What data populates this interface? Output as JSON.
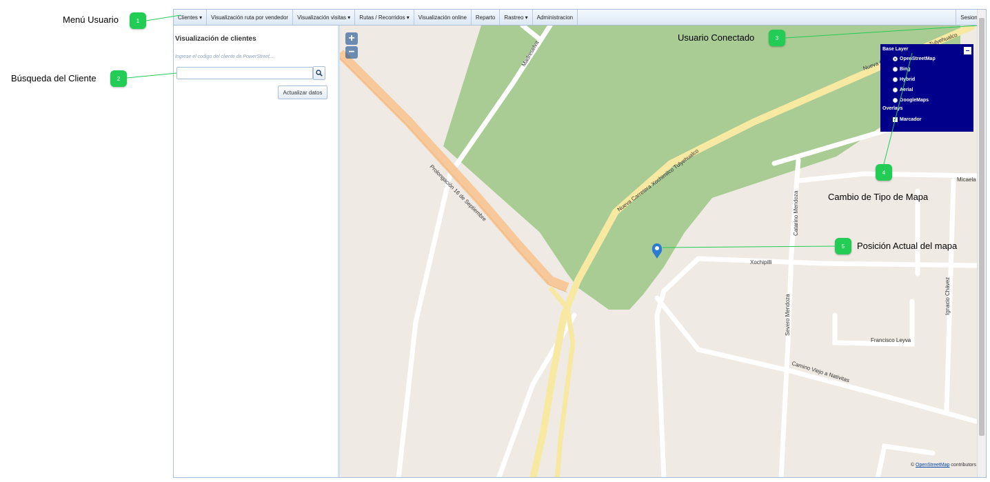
{
  "menu": {
    "items": [
      {
        "label": "Clientes ▾"
      },
      {
        "label": "Visualización ruta por vendedor"
      },
      {
        "label": "Visualización visitas ▾"
      },
      {
        "label": "Rutas / Recorridos ▾"
      },
      {
        "label": "Visualización online"
      },
      {
        "label": "Reparto"
      },
      {
        "label": "Rastreo ▾"
      },
      {
        "label": "Administracion"
      }
    ],
    "session_label": "Sesion ▾"
  },
  "sidebar": {
    "title": "Visualización de clientes",
    "hint": "Ingrese el codigo del cliente de PowerStreet...",
    "search_value": "",
    "refresh_label": "Actualizar datos"
  },
  "map": {
    "zoom_in": "+",
    "zoom_out": "−",
    "streets": {
      "madreselva": "Madreselva",
      "nueva_carretera": "Nueva Carretera Xochimilco Tulyehualco",
      "nueva_carretera_top": "Nueva Carretera Xochimilco Tulyehualco",
      "prolongacion": "Prolongación 16 de Septiembre",
      "catarino": "Catarino Mendoza",
      "xochipilli": "Xochipilli",
      "severo": "Severo Mendoza",
      "ignacio": "Ignacio Chávez",
      "francisco": "Francisco Leyva",
      "camino": "Camino Viejo a Nativitas",
      "micaela": "Micaela"
    },
    "attribution_prefix": "© ",
    "attribution_link": "OpenStreetMap",
    "attribution_suffix": " contributors"
  },
  "layers": {
    "base_title": "Base Layer",
    "options": [
      {
        "label": "OpenStreetMap",
        "selected": true
      },
      {
        "label": "Bing",
        "selected": false
      },
      {
        "label": "Hybrid",
        "selected": false
      },
      {
        "label": "Aerial",
        "selected": false
      },
      {
        "label": "GoogleMaps",
        "selected": false
      }
    ],
    "overlays_title": "Overlays",
    "overlay": {
      "label": "Marcador",
      "checked": true
    }
  },
  "callouts": [
    {
      "number": "1",
      "text": "Menú Usuario"
    },
    {
      "number": "2",
      "text": "Búsqueda del Cliente"
    },
    {
      "number": "3",
      "text": "Usuario Conectado"
    },
    {
      "number": "4",
      "text": "Cambio de Tipo de Mapa"
    },
    {
      "number": "5",
      "text": "Posición Actual del mapa"
    }
  ],
  "colors": {
    "badge": "#22cc55",
    "layer_panel": "#00008b",
    "park": "#a9cc94",
    "main_road": "#f7e9a1",
    "orange_road": "#f7c99a"
  }
}
